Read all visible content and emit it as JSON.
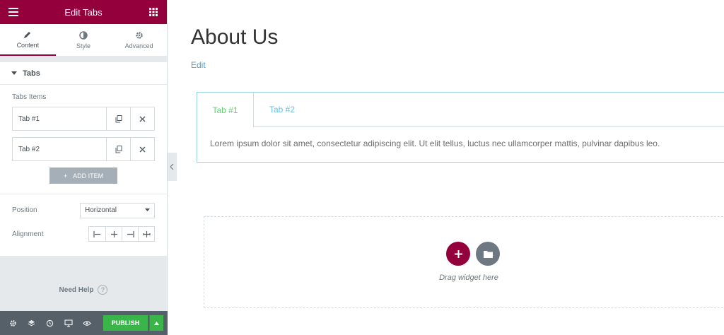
{
  "sidebar": {
    "header": {
      "title": "Edit Tabs"
    },
    "tabs": [
      {
        "label": "Content"
      },
      {
        "label": "Style"
      },
      {
        "label": "Advanced"
      }
    ],
    "section": {
      "title": "Tabs"
    },
    "tabs_items_label": "Tabs Items",
    "items": [
      {
        "label": "Tab #1"
      },
      {
        "label": "Tab #2"
      }
    ],
    "add_item_label": "ADD ITEM",
    "position": {
      "label": "Position",
      "value": "Horizontal"
    },
    "alignment": {
      "label": "Alignment"
    },
    "need_help": "Need Help",
    "footer": {
      "publish_label": "PUBLISH"
    }
  },
  "canvas": {
    "page_title": "About Us",
    "edit_link": "Edit",
    "tabs_widget": {
      "tabs": [
        {
          "label": "Tab #1"
        },
        {
          "label": "Tab #2"
        }
      ],
      "content": "Lorem ipsum dolor sit amet, consectetur adipiscing elit. Ut elit tellus, luctus nec ullamcorper mattis, pulvinar dapibus leo."
    },
    "drop_zone": {
      "text": "Drag widget here"
    }
  },
  "colors": {
    "brand": "#93003c",
    "publish": "#39b54a",
    "active_tab": "#61ce70",
    "inactive_tab": "#6ec1e4",
    "link": "#4aa3c8"
  }
}
